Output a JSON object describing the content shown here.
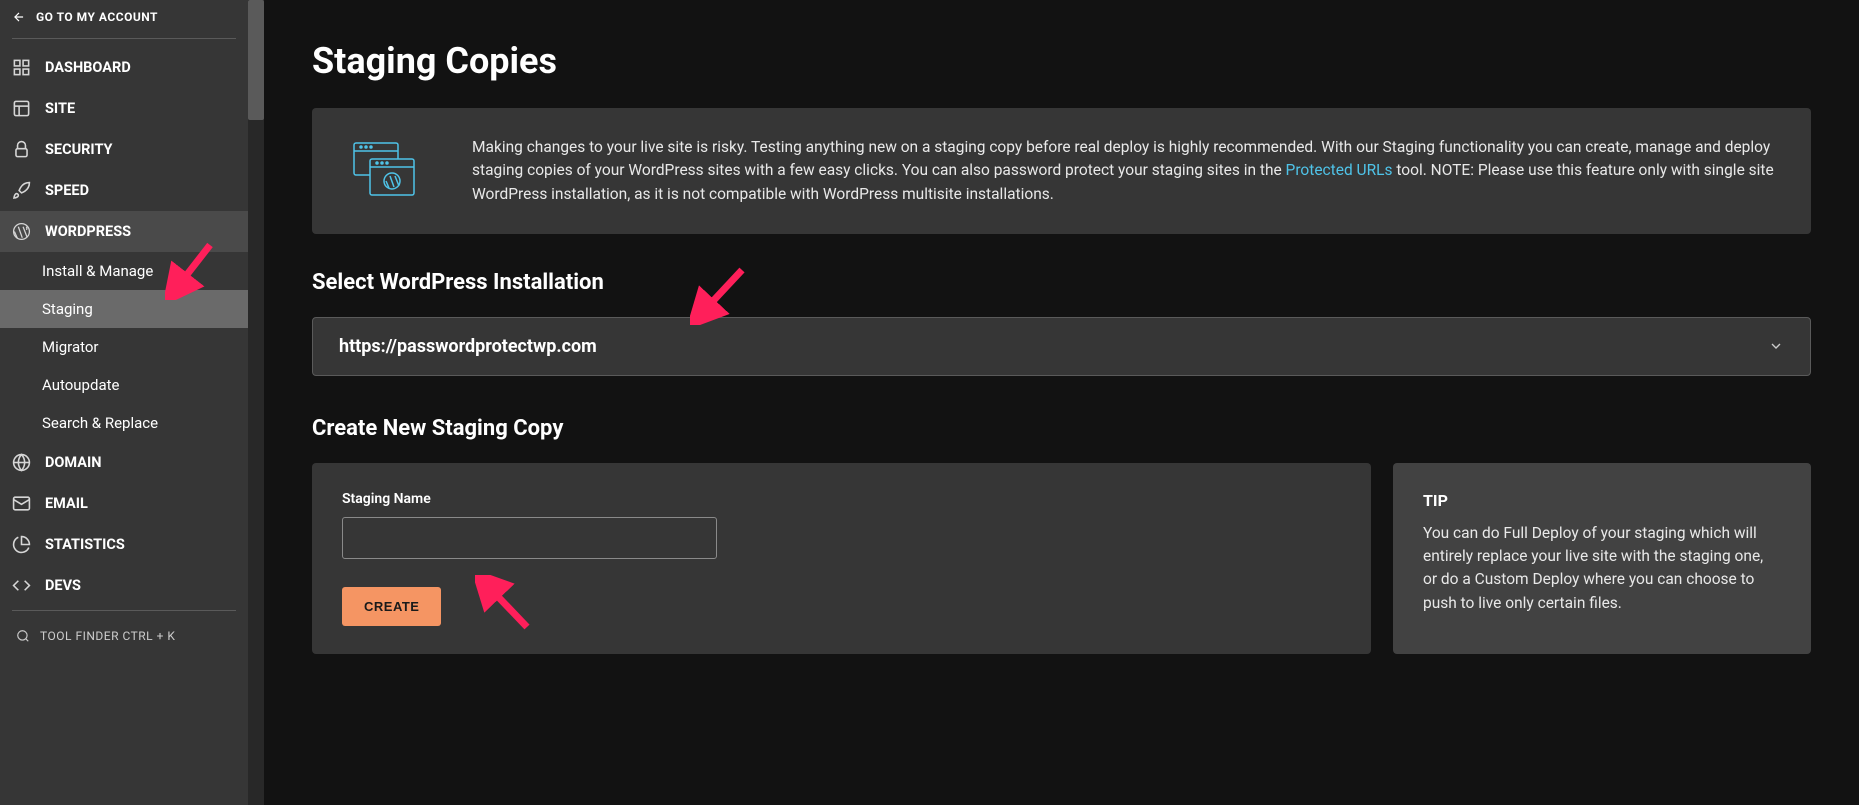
{
  "sidebar": {
    "back_label": "GO TO MY ACCOUNT",
    "items": [
      {
        "label": "DASHBOARD"
      },
      {
        "label": "SITE"
      },
      {
        "label": "SECURITY"
      },
      {
        "label": "SPEED"
      },
      {
        "label": "WORDPRESS"
      },
      {
        "label": "DOMAIN"
      },
      {
        "label": "EMAIL"
      },
      {
        "label": "STATISTICS"
      },
      {
        "label": "DEVS"
      }
    ],
    "wordpress_sub": [
      {
        "label": "Install & Manage"
      },
      {
        "label": "Staging"
      },
      {
        "label": "Migrator"
      },
      {
        "label": "Autoupdate"
      },
      {
        "label": "Search & Replace"
      }
    ],
    "tool_finder": "TOOL FINDER CTRL + K"
  },
  "page": {
    "title": "Staging Copies",
    "info_text_1": "Making changes to your live site is risky. Testing anything new on a staging copy before real deploy is highly recommended. With our Staging functionality you can create, manage and deploy staging copies of your WordPress sites with a few easy clicks. You can also password protect your staging sites in the ",
    "info_link": "Protected URLs",
    "info_text_2": " tool. NOTE: Please use this feature only with single site WordPress installation, as it is not compatible with WordPress multisite installations.",
    "select_title": "Select WordPress Installation",
    "select_value": "https://passwordprotectwp.com",
    "create_title": "Create New Staging Copy",
    "staging_name_label": "Staging Name",
    "create_button": "CREATE",
    "tip_title": "TIP",
    "tip_text": "You can do Full Deploy of your staging which will entirely replace your live site with the staging one, or do a Custom Deploy where you can choose to push to live only certain files."
  }
}
